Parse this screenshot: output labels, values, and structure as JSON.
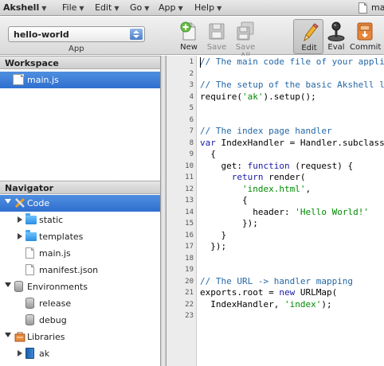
{
  "menubar": {
    "items": [
      {
        "label": "Akshell"
      },
      {
        "label": "File"
      },
      {
        "label": "Edit"
      },
      {
        "label": "Go"
      },
      {
        "label": "App"
      },
      {
        "label": "Help"
      }
    ],
    "open_file_partial": "ma"
  },
  "toolbar": {
    "app_select_value": "hello-world",
    "app_label": "App",
    "buttons": [
      {
        "label": "New",
        "icon": "new-file-icon",
        "enabled": true
      },
      {
        "label": "Save",
        "icon": "floppy-disk-icon",
        "enabled": false
      },
      {
        "label": "Save All",
        "icon": "floppy-disks-icon",
        "enabled": false
      },
      {
        "label": "Edit",
        "icon": "pencil-icon",
        "enabled": true,
        "active": true
      },
      {
        "label": "Eval",
        "icon": "joystick-icon",
        "enabled": true
      },
      {
        "label": "Commit",
        "icon": "archive-box-icon",
        "enabled": true
      }
    ]
  },
  "workspace": {
    "title": "Workspace",
    "items": [
      {
        "label": "main.js",
        "selected": true
      }
    ]
  },
  "navigator": {
    "title": "Navigator",
    "tree": [
      {
        "label": "Code",
        "expanded": true,
        "selected": true
      },
      {
        "label": "static"
      },
      {
        "label": "templates"
      },
      {
        "label": "main.js"
      },
      {
        "label": "manifest.json"
      },
      {
        "label": "Environments",
        "expanded": true
      },
      {
        "label": "release"
      },
      {
        "label": "debug"
      },
      {
        "label": "Libraries",
        "expanded": true
      },
      {
        "label": "ak"
      }
    ]
  },
  "editor": {
    "lines": [
      {
        "n": "1",
        "text": "// The main code file of your appli"
      },
      {
        "n": "2",
        "text": ""
      },
      {
        "n": "3",
        "text": "// The setup of the basic Akshell l"
      },
      {
        "n": "4",
        "text": "require('ak').setup();"
      },
      {
        "n": "5",
        "text": ""
      },
      {
        "n": "6",
        "text": ""
      },
      {
        "n": "7",
        "text": "// The index page handler"
      },
      {
        "n": "8",
        "text": "var IndexHandler = Handler.subclass"
      },
      {
        "n": "9",
        "text": "  {"
      },
      {
        "n": "10",
        "text": "    get: function (request) {"
      },
      {
        "n": "11",
        "text": "      return render("
      },
      {
        "n": "12",
        "text": "        'index.html',"
      },
      {
        "n": "13",
        "text": "        {"
      },
      {
        "n": "14",
        "text": "          header: 'Hello World!'"
      },
      {
        "n": "15",
        "text": "        });"
      },
      {
        "n": "16",
        "text": "    }"
      },
      {
        "n": "17",
        "text": "  });"
      },
      {
        "n": "18",
        "text": ""
      },
      {
        "n": "19",
        "text": ""
      },
      {
        "n": "20",
        "text": "// The URL -> handler mapping"
      },
      {
        "n": "21",
        "text": "exports.root = new URLMap("
      },
      {
        "n": "22",
        "text": "  IndexHandler, 'index');"
      },
      {
        "n": "23",
        "text": ""
      }
    ]
  }
}
